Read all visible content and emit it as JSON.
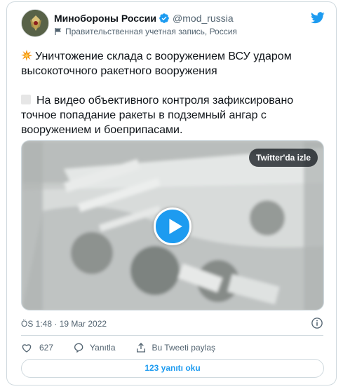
{
  "author": {
    "name": "Минобороны России",
    "handle": "@mod_russia",
    "affiliation": "Правительственная учетная запись, Россия",
    "verified_icon": "verified-badge-icon",
    "affiliation_icon": "government-flag-icon"
  },
  "tweet": {
    "line1_emoji": "collision-emoji-icon",
    "paragraph1": "Уничтожение склада с вооружением ВСУ ударом высокоточного ракетного вооружения",
    "paragraph2": "На видео объективного контроля зафиксировано точное попадание ракеты в подземный ангар с вооружением и боеприпасами."
  },
  "media": {
    "watch_on_twitter": "Twitter'da izle",
    "play_icon": "play-icon"
  },
  "timestamp": "ÖS 1:48 · 19 Mar 2022",
  "actions": {
    "like_count": "627",
    "reply_label": "Yanıtla",
    "share_label": "Bu Tweeti paylaş"
  },
  "replies_button": "123 yanıtı oku",
  "colors": {
    "accent": "#1d9bf0",
    "like_red": "#f91880",
    "secondary_text": "#536471",
    "border": "#cfd9de"
  }
}
